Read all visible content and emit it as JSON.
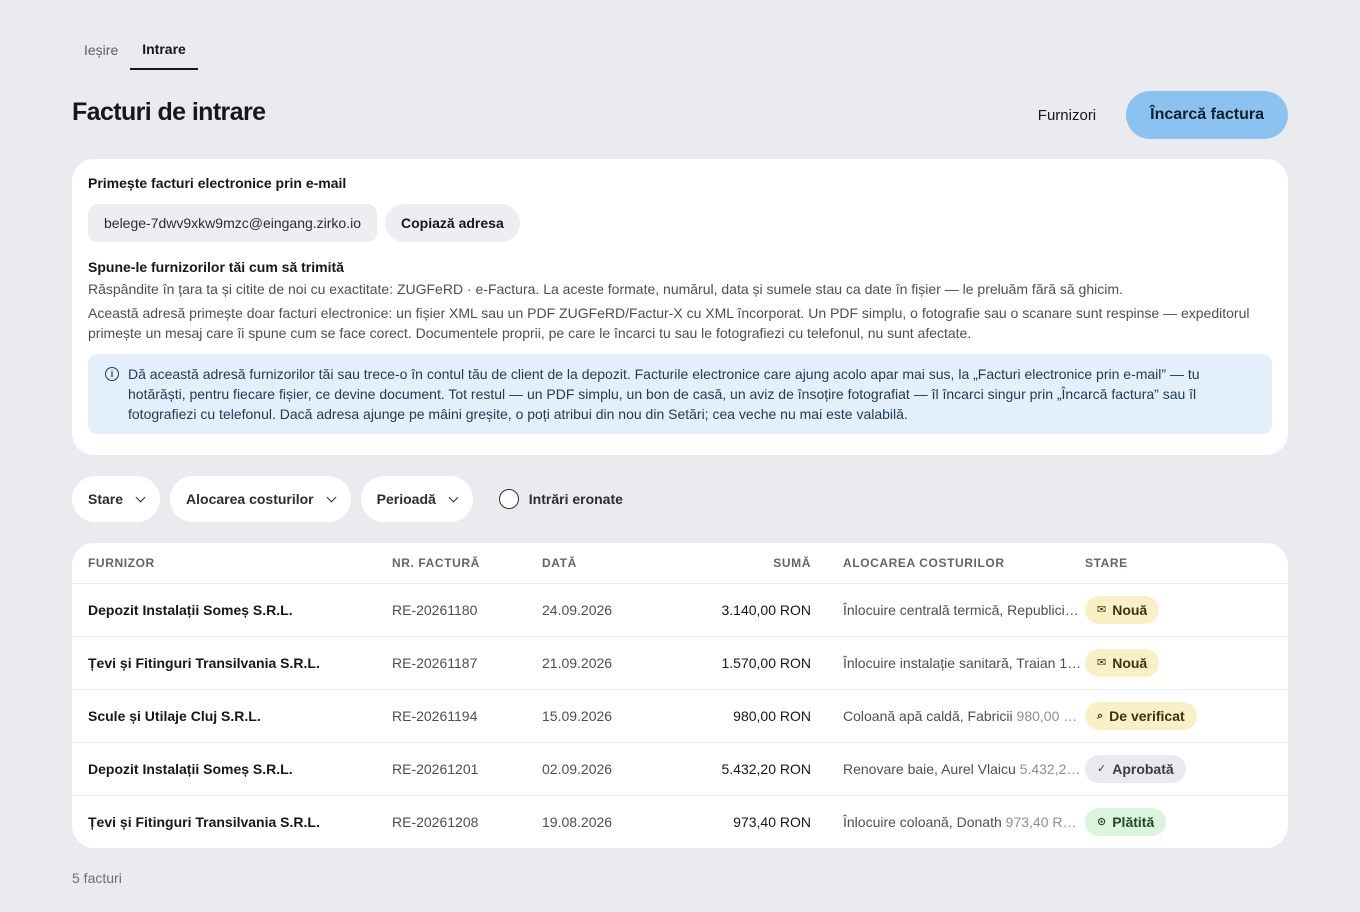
{
  "tabs": [
    {
      "label": "Ieșire"
    },
    {
      "label": "Intrare"
    }
  ],
  "header": {
    "title": "Facturi de intrare",
    "suppliers_link": "Furnizori",
    "upload_button": "Încarcă factura"
  },
  "email_card": {
    "heading": "Primește facturi electronice prin e-mail",
    "address": "belege-7dwv9xkw9mzc@eingang.zirko.io",
    "copy_button": "Copiază adresa",
    "subheading": "Spune-le furnizorilor tăi cum să trimită",
    "para1": "Răspândite în țara ta și citite de noi cu exactitate: ZUGFeRD · e-Factura. La aceste formate, numărul, data și sumele stau ca date în fișier — le preluăm fără să ghicim.",
    "para2": "Această adresă primește doar facturi electronice: un fișier XML sau un PDF ZUGFeRD/Factur-X cu XML încorporat. Un PDF simplu, o fotografie sau o scanare sunt respinse — expeditorul primește un mesaj care îi spune cum se face corect. Documentele proprii, pe care le încarci tu sau le fotografiezi cu telefonul, nu sunt afectate.",
    "info_icon": "info-icon",
    "info_text": "Dă această adresă furnizorilor tăi sau trece-o în contul tău de client de la depozit. Facturile electronice care ajung acolo apar mai sus, la „Facturi electronice prin e-mail” — tu hotărăști, pentru fiecare fișier, ce devine document. Tot restul — un PDF simplu, un bon de casă, un aviz de însoțire fotografiat — îl încarci singur prin „Încarcă factura” sau îl fotografiezi cu telefonul. Dacă adresa ajunge pe mâini greșite, o poți atribui din nou din Setări; cea veche nu mai este valabilă."
  },
  "filters": {
    "status": "Stare",
    "cost_allocation": "Alocarea costurilor",
    "period": "Perioadă",
    "erroneous": "Intrări eronate"
  },
  "table": {
    "headers": {
      "supplier": "FURNIZOR",
      "invoice_no": "NR. FACTURĂ",
      "date": "DATĂ",
      "amount": "SUMĂ",
      "allocation": "ALOCAREA COSTURILOR",
      "status": "STARE"
    },
    "rows": [
      {
        "supplier": "Depozit Instalații Someș S.R.L.",
        "invoice_no": "RE-20261180",
        "date": "24.09.2026",
        "amount": "3.140,00 RON",
        "allocation": "Înlocuire centrală termică, Republici…",
        "allocation_amount": "",
        "status": "Nouă",
        "status_icon": "✉",
        "status_color": "yellow"
      },
      {
        "supplier": "Țevi și Fitinguri Transilvania S.R.L.",
        "invoice_no": "RE-20261187",
        "date": "21.09.2026",
        "amount": "1.570,00 RON",
        "allocation": "Înlocuire instalație sanitară, Traian 1…",
        "allocation_amount": "",
        "status": "Nouă",
        "status_icon": "✉",
        "status_color": "yellow"
      },
      {
        "supplier": "Scule și Utilaje Cluj S.R.L.",
        "invoice_no": "RE-20261194",
        "date": "15.09.2026",
        "amount": "980,00 RON",
        "allocation": "Coloană apă caldă, Fabricii",
        "allocation_amount": "980,00 …",
        "status": "De verificat",
        "status_icon": "⌕",
        "status_color": "yellow"
      },
      {
        "supplier": "Depozit Instalații Someș S.R.L.",
        "invoice_no": "RE-20261201",
        "date": "02.09.2026",
        "amount": "5.432,20 RON",
        "allocation": "Renovare baie, Aurel Vlaicu",
        "allocation_amount": "5.432,2…",
        "status": "Aprobată",
        "status_icon": "✓",
        "status_color": "gray"
      },
      {
        "supplier": "Țevi și Fitinguri Transilvania S.R.L.",
        "invoice_no": "RE-20261208",
        "date": "19.08.2026",
        "amount": "973,40 RON",
        "allocation": "Înlocuire coloană, Donath",
        "allocation_amount": "973,40 R…",
        "status": "Plătită",
        "status_icon": "⊙",
        "status_color": "green"
      }
    ]
  },
  "footer": {
    "count": "5 facturi"
  }
}
